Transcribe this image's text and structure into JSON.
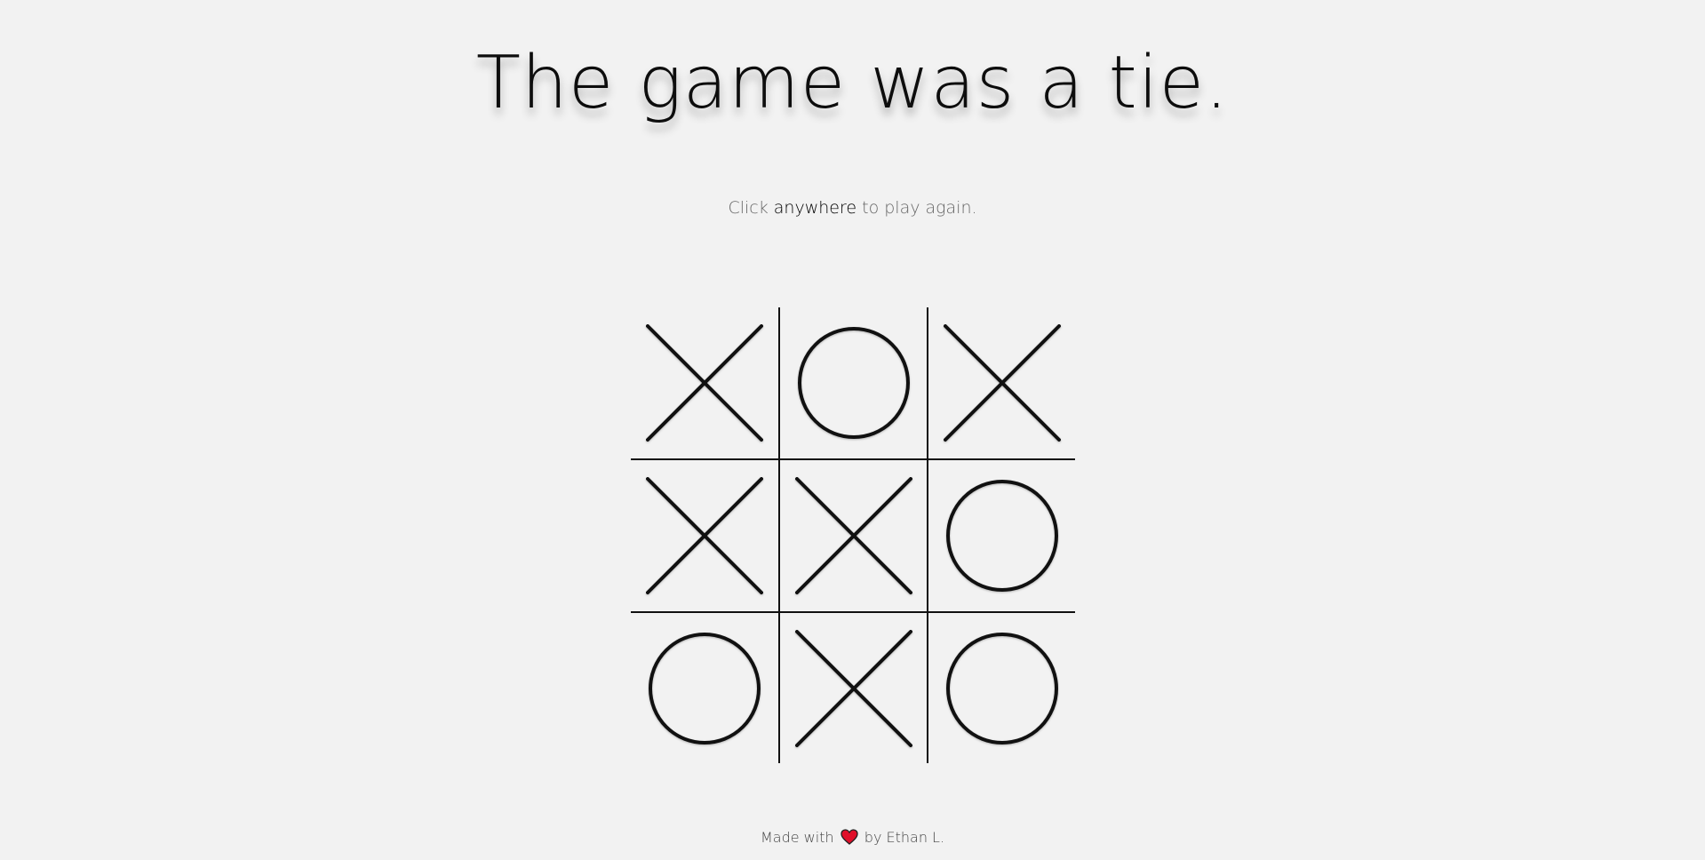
{
  "title": "The game was a tie.",
  "instructions": {
    "before": "Click ",
    "emphasis": "anywhere",
    "after": " to play again."
  },
  "board": {
    "cells": [
      "X",
      "O",
      "X",
      "X",
      "X",
      "O",
      "O",
      "X",
      "O"
    ]
  },
  "footer": {
    "before": "Made with",
    "icon": "heart-icon",
    "after": "by Ethan L."
  },
  "colors": {
    "background": "#f2f2f2",
    "marks": "#111111",
    "heart": "#e0102a"
  }
}
